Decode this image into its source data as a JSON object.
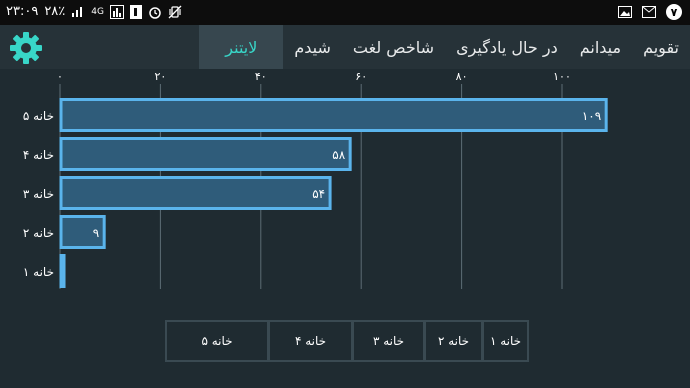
{
  "status_bar": {
    "time": "۲۳:۰۹",
    "battery": "۲۸٪",
    "network": "4G",
    "notification_count": "۷"
  },
  "tabs": [
    {
      "label": "تقویم"
    },
    {
      "label": "میدانم"
    },
    {
      "label": "در حال یادگیری"
    },
    {
      "label": "شاخص لغت"
    },
    {
      "label": "شیدم"
    },
    {
      "label": "لایتنر"
    }
  ],
  "active_tab": 5,
  "colors": {
    "accent": "#38d6c8",
    "bar_fill": "#2f5c7a",
    "bar_stroke": "#5ab4ec",
    "background": "#1f2b31",
    "appbar": "#263238",
    "active_tab_bg": "#37474f"
  },
  "chart_data": {
    "type": "bar",
    "orientation": "horizontal",
    "categories": [
      "خانه ۵",
      "خانه ۴",
      "خانه ۳",
      "خانه ۲",
      "خانه ۱"
    ],
    "values": [
      109,
      58,
      54,
      9,
      1
    ],
    "value_labels": [
      "۱۰۹",
      "۵۸",
      "۵۴",
      "۹",
      ""
    ],
    "xlim": [
      0,
      110
    ],
    "xticks": [
      0,
      20,
      40,
      60,
      80,
      100
    ],
    "xtick_labels": [
      "۰",
      "۲۰",
      "۴۰",
      "۶۰",
      "۸۰",
      "۱۰۰"
    ],
    "grid": true
  },
  "legend": {
    "items": [
      "خانه ۱",
      "خانه ۲",
      "خانه ۳",
      "خانه ۴",
      "خانه ۵"
    ]
  }
}
